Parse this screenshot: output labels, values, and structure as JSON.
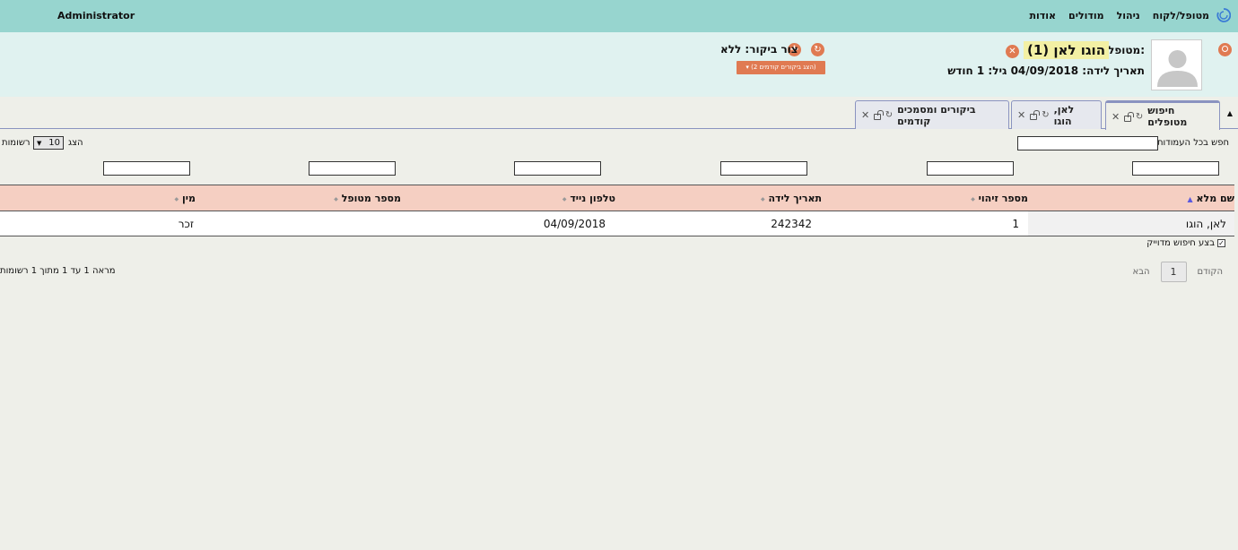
{
  "menubar": {
    "items": [
      "מטופל/לקוח",
      "ניהול",
      "מודולים",
      "אודות"
    ],
    "user": "Administrator"
  },
  "patient": {
    "label": "מטופל:",
    "name": "הוגו לאן  (1)",
    "dob_line": "תאריך לידה: 04/09/2018 גיל: 1 חודש",
    "visit_label": "צור ביקור: ללא",
    "prev_visits_button": "▾ (הצג ביקורים קודמים 2)"
  },
  "tabs": [
    {
      "label": "חיפוש מטופלים",
      "active": true
    },
    {
      "label": "לאן, הוגו",
      "active": false
    },
    {
      "label": "ביקורים ומסמכים קודמים",
      "active": false
    }
  ],
  "search": {
    "global_label": "חפש בכל העמודות:",
    "show_label": "הצג",
    "length_value": "10",
    "rows_label": "רשומות"
  },
  "table": {
    "headers": [
      "שם מלא",
      "מספר זיהוי",
      "תאריך לידה",
      "טלפון נייד",
      "מספר מטופל",
      "מין"
    ],
    "rows": [
      [
        "לאן, הוגו",
        "1",
        "242342",
        "04/09/2018",
        "",
        "זכר"
      ]
    ]
  },
  "exact_search": {
    "label": "בצע חיפוש מדוייק",
    "checked": true
  },
  "pagination": {
    "prev": "הקודם",
    "page": "1",
    "next": "הבא",
    "info": "מראה 1 עד 1 מתוך 1 רשומות"
  },
  "colors": {
    "menubar": "#97d5cf",
    "header": "#e0f2f0",
    "accent": "#e07a52",
    "table_header": "#f5cfc2"
  }
}
